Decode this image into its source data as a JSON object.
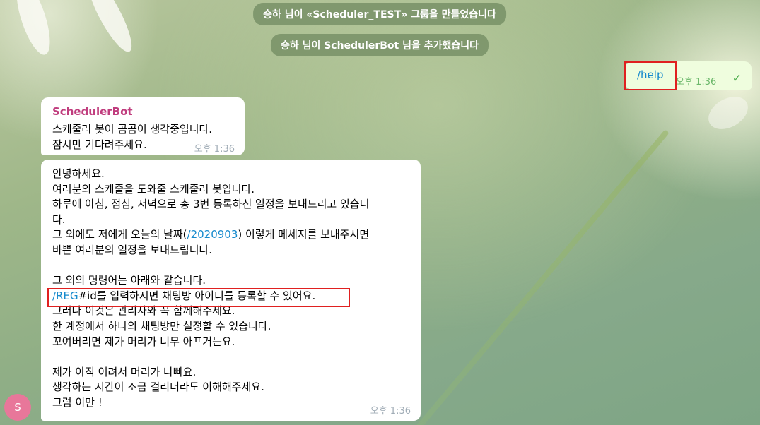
{
  "service_messages": [
    "승하 님이 «Scheduler_TEST» 그룹을 만들었습니다",
    "승하 님이 SchedulerBot 님을 추가했습니다"
  ],
  "outgoing": {
    "text": "/help",
    "time": "오후 1:36",
    "status_icon": "double-check-icon"
  },
  "bubble1": {
    "sender": "SchedulerBot",
    "lines": [
      "스케줄러 봇이 곰곰이 생각중입니다.",
      "잠시만 기다려주세요."
    ],
    "time": "오후 1:36"
  },
  "bubble2": {
    "lines": [
      "안녕하세요.",
      "여러분의 스케줄을 도와줄 스케줄러 봇입니다.",
      "하루에 아침, 점심, 저녁으로 총 3번 등록하신 일정을 보내드리고 있습니",
      "다.",
      "그 외에도 저에게 오늘의 날짜(",
      "/2020903",
      ") 이렇게 메세지를 보내주시면",
      "바쁜 여러분의 일정을 보내드립니다.",
      "",
      "그 외의 명령어는 아래와 같습니다.",
      "/REG",
      "#id를 입력하시면 채팅방 아이디를 등록할 수 있어요.",
      "그러나 이것은 관리자와 꼭 함께해주세요.",
      "한 계정에서 하나의 채팅방만 설정할 수 있습니다.",
      "꼬여버리면 제가 머리가 너무 아프거든요.",
      "",
      "제가 아직 어려서 머리가 나빠요.",
      "생각하는 시간이 조금 걸리더라도 이해해주세요.",
      "그럼 이만 !"
    ],
    "time": "오후 1:36"
  },
  "avatar": {
    "initial": "S",
    "color": "#e8779a"
  },
  "colors": {
    "link": "#168acd",
    "sender": "#c03d7e",
    "highlight": "#e02020",
    "outgoing_bg": "#effdde"
  }
}
